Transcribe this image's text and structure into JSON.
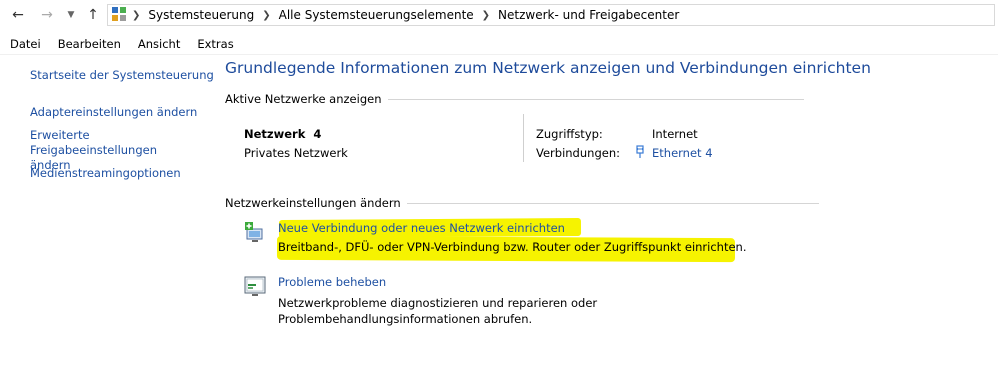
{
  "address": {
    "breadcrumbs": [
      "Systemsteuerung",
      "Alle Systemsteuerungselemente",
      "Netzwerk- und Freigabecenter"
    ]
  },
  "menu": [
    "Datei",
    "Bearbeiten",
    "Ansicht",
    "Extras"
  ],
  "sidebar": {
    "items": [
      {
        "label": "Startseite der Systemsteuerung"
      },
      {
        "label": "Adaptereinstellungen ändern"
      },
      {
        "label": "Erweiterte Freigabeeinstellungen ändern"
      },
      {
        "label": "Medienstreamingoptionen"
      }
    ]
  },
  "main": {
    "title": "Grundlegende Informationen zum Netzwerk anzeigen und Verbindungen einrichten",
    "active_networks_heading": "Aktive Netzwerke anzeigen",
    "network": {
      "name": "Netzwerk  4",
      "type": "Privates Netzwerk",
      "access_label": "Zugriffstyp:",
      "access_value": "Internet",
      "connections_label": "Verbindungen:",
      "connections_value": "Ethernet 4"
    },
    "change_settings_heading": "Netzwerkeinstellungen ändern",
    "actions": [
      {
        "title": "Neue Verbindung oder neues Netzwerk einrichten",
        "description": "Breitband-, DFÜ- oder VPN-Verbindung bzw. Router oder Zugriffspunkt einrichten."
      },
      {
        "title": "Probleme beheben",
        "description": "Netzwerkprobleme diagnostizieren und reparieren oder Problembehandlungsinformationen abrufen."
      }
    ]
  },
  "colors": {
    "link": "#1e50a2",
    "title": "#1e4b9b",
    "highlight": "#f6f300"
  }
}
